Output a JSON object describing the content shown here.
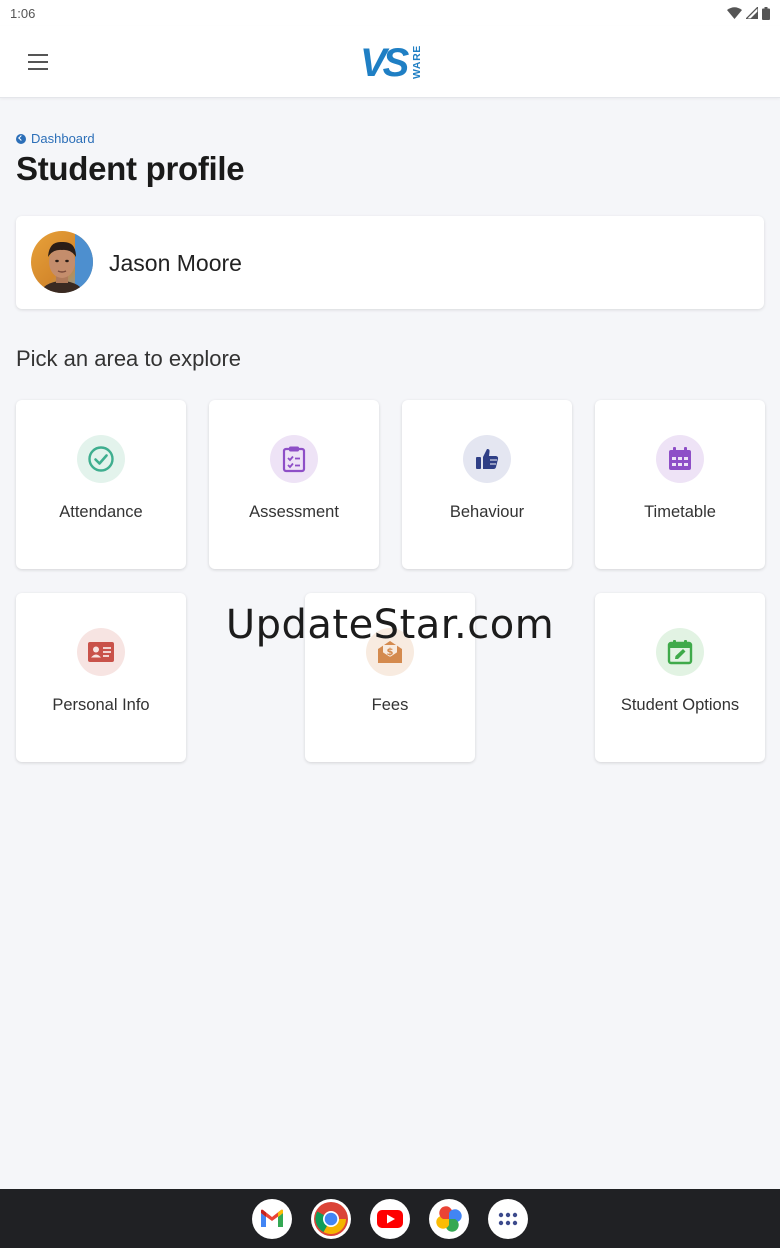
{
  "status_bar": {
    "time": "1:06"
  },
  "header": {
    "menu_icon": "hamburger-menu-icon",
    "logo": "vsware-logo",
    "logo_text": "VSWARE"
  },
  "breadcrumb": {
    "label": "Dashboard",
    "icon": "back-arrow-icon"
  },
  "page": {
    "title": "Student profile"
  },
  "student": {
    "name": "Jason Moore"
  },
  "areas": {
    "heading": "Pick an area to explore",
    "items": [
      {
        "label": "Attendance",
        "icon": "check-circle-icon",
        "color": "#3fae8f",
        "bg": "#e3f3ec"
      },
      {
        "label": "Assessment",
        "icon": "clipboard-icon",
        "color": "#8e4fc7",
        "bg": "#eee3f6"
      },
      {
        "label": "Behaviour",
        "icon": "thumbs-up-icon",
        "color": "#2f3f86",
        "bg": "#e4e6f1"
      },
      {
        "label": "Timetable",
        "icon": "calendar-grid-icon",
        "color": "#8e4fc7",
        "bg": "#eee3f6"
      },
      {
        "label": "Personal Info",
        "icon": "id-card-icon",
        "color": "#c9524a",
        "bg": "#f7e4e2"
      },
      {
        "label": "Fees",
        "icon": "money-envelope-icon",
        "color": "#d48a4e",
        "bg": "#f8ebe0"
      },
      {
        "label": "Student Options",
        "icon": "calendar-edit-icon",
        "color": "#3faa4a",
        "bg": "#e2f3e3"
      }
    ]
  },
  "watermark": "UpdateStar.com",
  "taskbar": {
    "apps": [
      "gmail-icon",
      "chrome-icon",
      "youtube-icon",
      "photos-icon",
      "app-drawer-icon"
    ]
  }
}
